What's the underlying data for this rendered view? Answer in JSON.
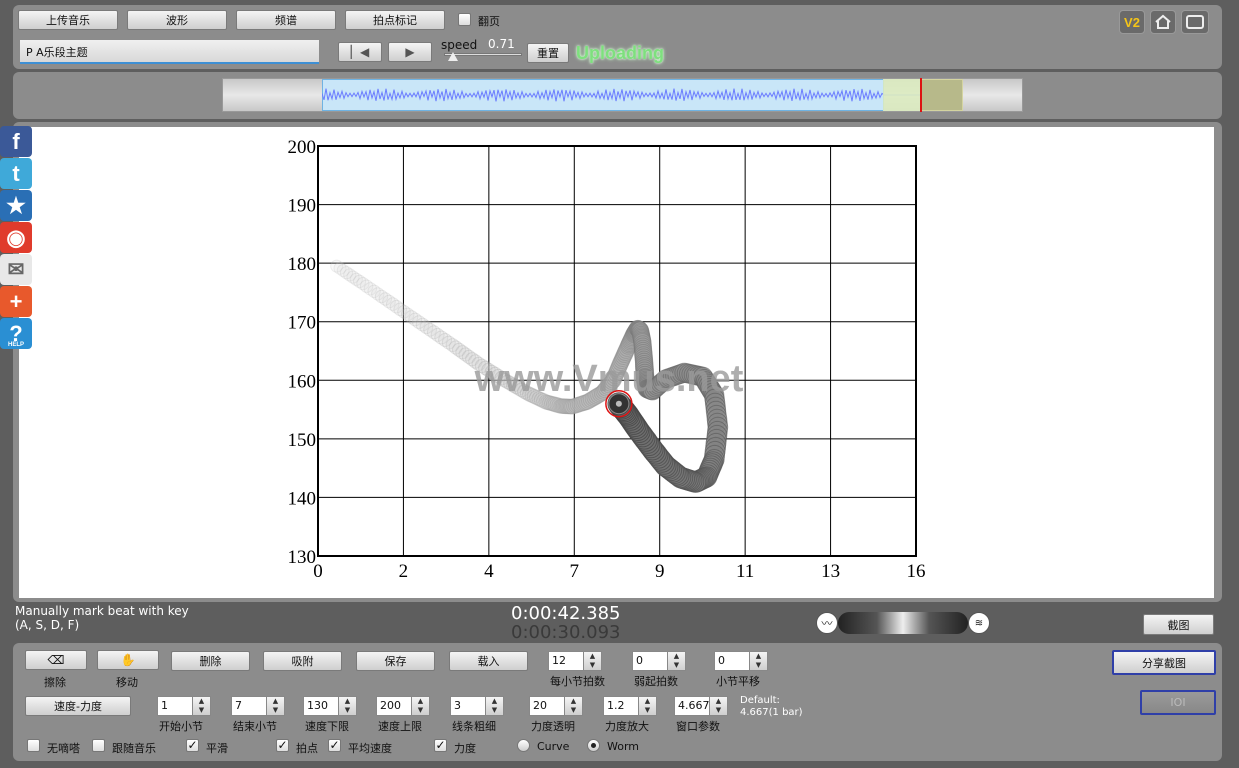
{
  "toolbar": {
    "upload_music": "上传音乐",
    "waveform": "波形",
    "spectrum": "频谱",
    "beat_mark": "拍点标记",
    "page_turn": "翻页",
    "title_value": "P A乐段主题",
    "speed_label": "speed",
    "speed_value": "0.71",
    "reset": "重置",
    "status": "Uploading",
    "v2_label": "V2"
  },
  "share": {
    "items": [
      {
        "name": "facebook-icon",
        "glyph": "f",
        "color": "#3b5998"
      },
      {
        "name": "twitter-icon",
        "glyph": "t",
        "color": "#3fa9d9"
      },
      {
        "name": "favorite-star-icon",
        "glyph": "★",
        "color": "#2a6fb5"
      },
      {
        "name": "weibo-icon",
        "glyph": "◉",
        "color": "#e03b2c"
      },
      {
        "name": "email-icon",
        "glyph": "✉",
        "color": "#e8e8e8"
      },
      {
        "name": "plus-share-icon",
        "glyph": "+",
        "color": "#e8592c"
      },
      {
        "name": "help-icon",
        "glyph": "?",
        "color": "#2a8fd3"
      }
    ],
    "help_text": "HELP"
  },
  "chart_data": {
    "type": "line",
    "title": "",
    "xlabel": "",
    "ylabel": "",
    "x_ticks": [
      "0",
      "2",
      "4",
      "7",
      "9",
      "11",
      "13",
      "16"
    ],
    "y_ticks": [
      "130",
      "140",
      "150",
      "160",
      "170",
      "180",
      "190",
      "200"
    ],
    "xlim": [
      0,
      16
    ],
    "ylim": [
      130,
      200
    ],
    "grid": true,
    "watermark": "www.Vmus.net",
    "series": [
      {
        "style": "worm",
        "x": [
          0.5,
          1.2,
          2.0,
          2.8,
          3.6,
          4.3,
          5.0,
          5.6,
          6.1,
          6.5,
          6.8,
          7.2,
          7.6,
          7.9,
          8.1,
          8.3,
          8.45,
          8.55,
          8.62,
          8.68,
          8.72,
          8.75,
          8.8,
          8.95,
          9.3,
          9.8,
          10.3,
          10.6,
          10.7,
          10.6,
          10.4,
          10.1,
          9.7,
          9.3,
          8.95,
          8.6,
          8.3,
          8.05
        ],
        "y": [
          179.5,
          176.5,
          173.0,
          169.5,
          166.0,
          162.8,
          160.0,
          157.8,
          156.3,
          155.6,
          155.5,
          156.3,
          157.8,
          160.0,
          163.0,
          165.8,
          167.8,
          168.8,
          168.5,
          166.5,
          163.5,
          160.5,
          158.6,
          158.2,
          160.2,
          161.3,
          160.6,
          157.5,
          152.0,
          146.5,
          143.5,
          142.6,
          143.4,
          145.4,
          148.2,
          151.2,
          154.0,
          156.0
        ]
      }
    ],
    "current_point": {
      "x": 8.05,
      "y": 156.0
    }
  },
  "status_bar": {
    "hint_line1": "Manually mark beat with key",
    "hint_line2": "(A, S, D, F)",
    "time_current": "0:00:42.385",
    "time_secondary": "0:00:30.093",
    "screenshot": "截图"
  },
  "bottom": {
    "erase": "擦除",
    "move": "移动",
    "delete": "删除",
    "snap": "吸附",
    "save": "保存",
    "load": "载入",
    "share_screenshot": "分享截图",
    "ioi": "IOI",
    "mode": "速度-力度",
    "default_note_1": "Default:",
    "default_note_2": "4.667(1 bar)",
    "spinners_row1": [
      {
        "label": "每小节拍数",
        "value": "12"
      },
      {
        "label": "弱起拍数",
        "value": "0"
      },
      {
        "label": "小节平移",
        "value": "0"
      }
    ],
    "spinners_row2": [
      {
        "label": "开始小节",
        "value": "1"
      },
      {
        "label": "结束小节",
        "value": "7"
      },
      {
        "label": "速度下限",
        "value": "130"
      },
      {
        "label": "速度上限",
        "value": "200"
      },
      {
        "label": "线条粗细",
        "value": "3"
      },
      {
        "label": "力度透明",
        "value": "20"
      },
      {
        "label": "力度放大",
        "value": "1.2"
      },
      {
        "label": "窗口参数",
        "value": "4.667"
      }
    ],
    "options": [
      {
        "label": "无嘀嗒",
        "checked": false
      },
      {
        "label": "跟随音乐",
        "checked": false
      },
      {
        "label": "平滑",
        "checked": true
      },
      {
        "label": "拍点",
        "checked": true
      },
      {
        "label": "平均速度",
        "checked": true
      },
      {
        "label": "力度",
        "checked": true
      }
    ],
    "radio_curve": "Curve",
    "radio_worm": "Worm"
  }
}
